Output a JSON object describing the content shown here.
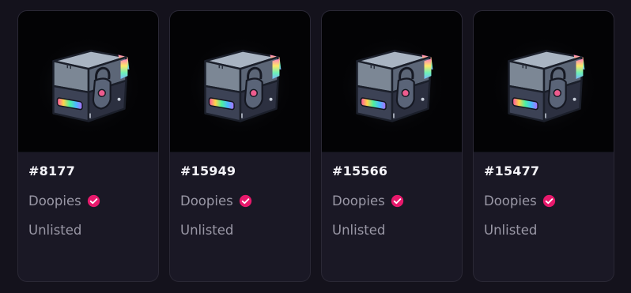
{
  "cards": [
    {
      "id": "#8177",
      "collection": "Doopies",
      "status": "Unlisted"
    },
    {
      "id": "#15949",
      "collection": "Doopies",
      "status": "Unlisted"
    },
    {
      "id": "#15566",
      "collection": "Doopies",
      "status": "Unlisted"
    },
    {
      "id": "#15477",
      "collection": "Doopies",
      "status": "Unlisted"
    }
  ],
  "colors": {
    "background": "#14121c",
    "card": "#1a1825",
    "border": "#2a2835",
    "verified_badge": "#e8196c",
    "muted_text": "#9a98a6"
  },
  "icons": {
    "nft_image": "locked-cube-icon",
    "verified": "verified-check-icon"
  }
}
